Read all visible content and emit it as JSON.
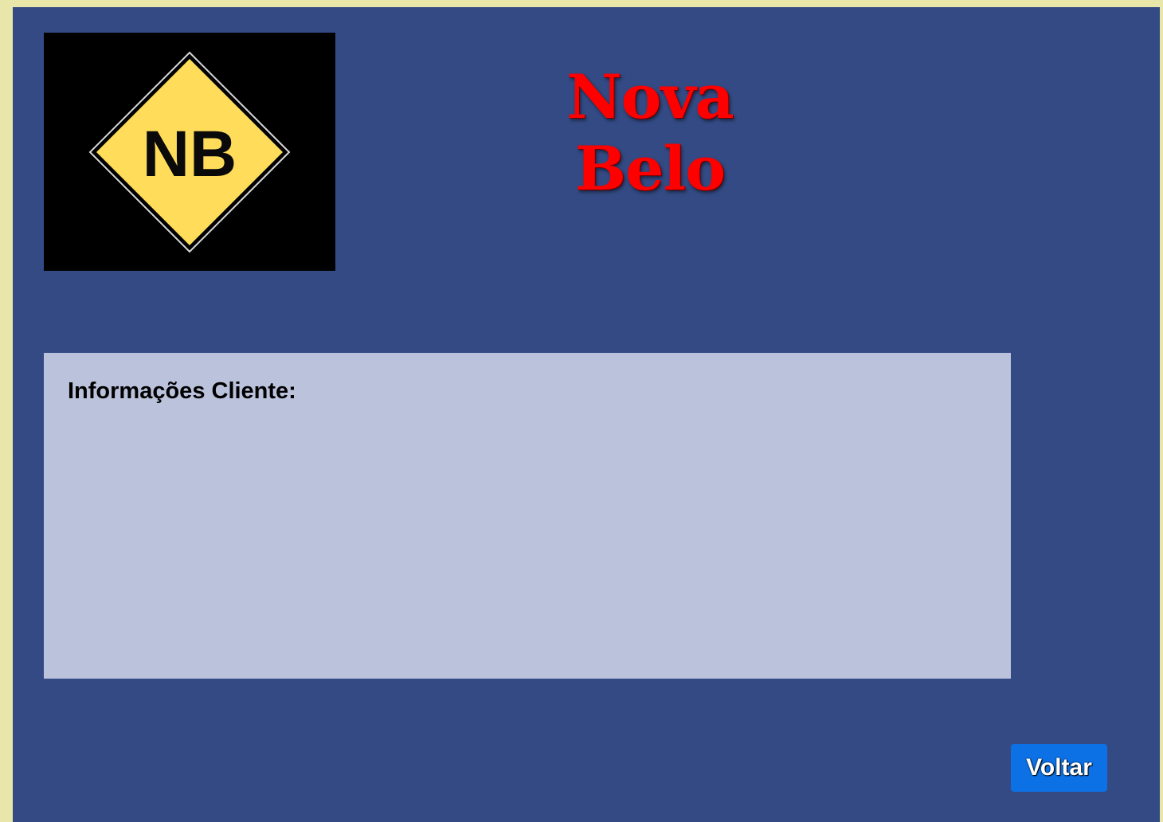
{
  "header": {
    "logo": {
      "icon": "nb-diamond-logo-icon",
      "text": "NB",
      "background_color": "#000000",
      "diamond_color": "#ffdc5a"
    },
    "title": "Nova Belo",
    "title_color": "#ff0000"
  },
  "main": {
    "panel_heading": "Informações Cliente:",
    "panel_color": "#bbc2dc",
    "background_color": "#334a84"
  },
  "footer": {
    "back_button_label": "Voltar",
    "back_button_color": "#0d71e6"
  }
}
